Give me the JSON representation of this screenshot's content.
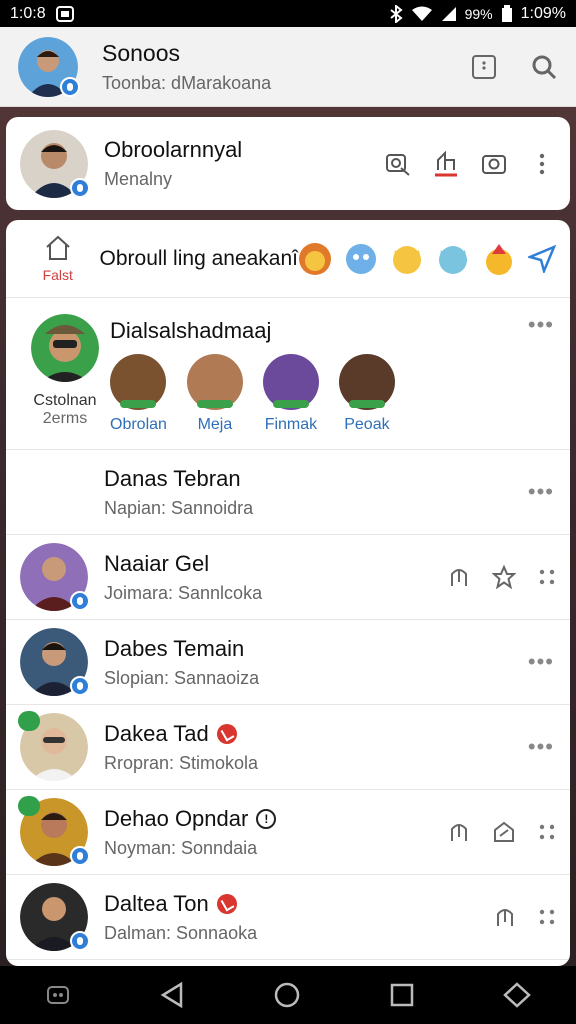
{
  "status_bar": {
    "time": "1:0:8",
    "battery": "99%",
    "clock_right": "1:09%"
  },
  "header": {
    "title": "Sonoos",
    "subtitle": "Toonba: dMarakoana",
    "avatar_color": "#2f7fd8"
  },
  "contact": {
    "name": "Obroolarnnyal",
    "subtitle": "Menalny"
  },
  "status_row": {
    "home_label": "Falst",
    "text": "Obroull ling aneakanî"
  },
  "group": {
    "title": "Dialsalshadmaaj",
    "left_caption": "Cstolnan",
    "left_caption2": "2erms",
    "members": [
      {
        "name": "Obrolan",
        "color": "#7a5230"
      },
      {
        "name": "Meja",
        "color": "#b07a55"
      },
      {
        "name": "Finmak",
        "color": "#6b4a9b"
      },
      {
        "name": "Peoak",
        "color": "#5a3a28"
      }
    ]
  },
  "rows": [
    {
      "name": "Danas Tebran",
      "sub": "Napian: Sannoidra",
      "avatar": false
    },
    {
      "name": "Naaiar Gel",
      "sub": "Joimara: Sannlcoka",
      "avatar": true,
      "bg": "#8e6fb8"
    },
    {
      "name": "Dabes Temain",
      "sub": "Slopian: Sannaoiza",
      "avatar": true,
      "bg": "#3b5a7a"
    },
    {
      "name": "Dakea Tad",
      "sub": "Rropran: Stimokola",
      "avatar": true,
      "bg": "#d9c8a8"
    },
    {
      "name": "Dehao Opndar",
      "sub": "Noyman: Sonndaia",
      "avatar": true,
      "bg": "#8a5a2a"
    },
    {
      "name": "Daltea Ton",
      "sub": "Dalman: Sonnaoka",
      "avatar": true,
      "bg": "#2a2a2a"
    }
  ],
  "more": "•••"
}
